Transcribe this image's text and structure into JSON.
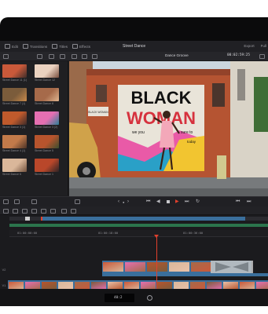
{
  "menubar": {
    "items": [
      {
        "label": "Edit",
        "icon": "grid-icon"
      },
      {
        "label": "Transitions",
        "icon": "transitions-icon"
      },
      {
        "label": "Titles",
        "icon": "titles-icon"
      },
      {
        "label": "Effects",
        "icon": "effects-icon"
      }
    ],
    "project_title": "Street Dance",
    "right_items": [
      "Export",
      "Full"
    ]
  },
  "viewer_bar": {
    "timeline_name": "Dance Groove",
    "timecode": "00:02:59:25"
  },
  "media_pool": {
    "clips": [
      {
        "label": "Street Dance 11 (1)",
        "colors": [
          "#c9593a",
          "#3f2d2a"
        ]
      },
      {
        "label": "Street Dance 12",
        "colors": [
          "#ead2c0",
          "#7a4f3f"
        ]
      },
      {
        "label": "Street Dance 7 (1)",
        "colors": [
          "#7b5c3b",
          "#c98a4b"
        ]
      },
      {
        "label": "Street Dance 8",
        "colors": [
          "#a66a4a",
          "#e0b58f"
        ]
      },
      {
        "label": "Street Dance 3 (1)",
        "colors": [
          "#bf5a2c",
          "#3b2a2a"
        ]
      },
      {
        "label": "Street Dance 3 (2)",
        "colors": [
          "#e46fb1",
          "#2a7f96"
        ]
      },
      {
        "label": "Street Dance 4 (1)",
        "colors": [
          "#c27a4a",
          "#4a3226"
        ]
      },
      {
        "label": "Street Dance 5",
        "colors": [
          "#b7542d",
          "#3a4f2f"
        ]
      },
      {
        "label": "Street Dance 6",
        "colors": [
          "#dab79a",
          "#73533f"
        ]
      },
      {
        "label": "Street Dance 1",
        "colors": [
          "#b9472a",
          "#2d2426"
        ]
      }
    ]
  },
  "viewer": {
    "mural_line1": "BLACK",
    "mural_line2": "WOMAN",
    "mural_small_left": "we you",
    "mural_small_right": "sure to",
    "mural_small_bottom": "today",
    "mural_side_text": "BLACK WOMAN"
  },
  "timeline": {
    "ruler_labels": [
      "01:00:00:00",
      "01:00:18:00",
      "01:00:36:00"
    ],
    "track_labels": [
      "V2",
      "V1",
      "A1"
    ]
  },
  "bottom_bar": {
    "timecode_display": "40:2"
  },
  "colors": {
    "accent": "#e2402c",
    "video_track": "#3a6f9c",
    "audio_track": "#2f8b58"
  }
}
